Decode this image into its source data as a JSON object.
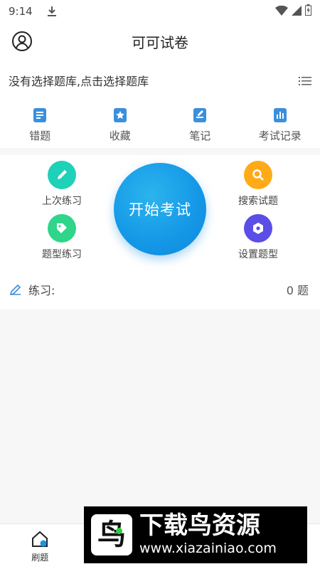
{
  "status_bar": {
    "time": "9:14"
  },
  "header": {
    "title": "可可试卷"
  },
  "question_bank": {
    "prompt": "没有选择题库,点击选择题库"
  },
  "quick_actions": [
    {
      "label": "错题",
      "icon": "wrong-questions-icon"
    },
    {
      "label": "收藏",
      "icon": "favorites-icon"
    },
    {
      "label": "笔记",
      "icon": "notes-icon"
    },
    {
      "label": "考试记录",
      "icon": "exam-record-icon"
    }
  ],
  "features": {
    "last_practice": "上次练习",
    "type_practice": "题型练习",
    "search": "搜索试题",
    "settings": "设置题型",
    "start_exam": "开始考试"
  },
  "practice": {
    "label": "练习:",
    "count": "0 题"
  },
  "bottom_nav": {
    "active_tab": "刷题"
  },
  "watermark": {
    "brand": "下载鸟资源",
    "url": "www.xiazainiao.com"
  },
  "colors": {
    "primary": "#1497e6",
    "teal": "#1fd1b9",
    "green": "#2fd58a",
    "orange": "#ffaa18",
    "purple": "#5b4ee6",
    "icon_blue": "#3a8fdc"
  }
}
